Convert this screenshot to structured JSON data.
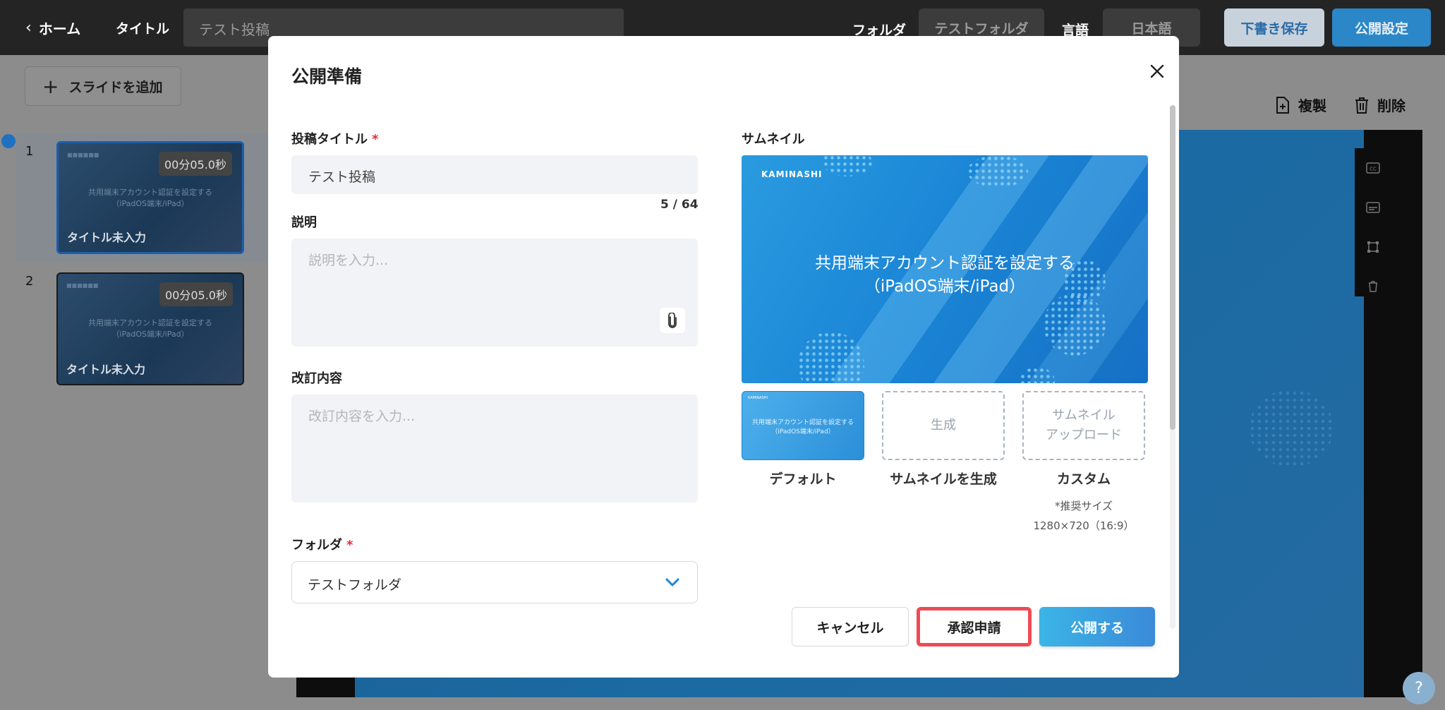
{
  "topbar": {
    "home_label": "ホーム",
    "title_label": "タイトル",
    "title_value": "テスト投稿",
    "folder_label": "フォルダ",
    "folder_value": "テストフォルダ",
    "language_label": "言語",
    "language_value": "日本語",
    "save_draft": "下書き保存",
    "publish_settings": "公開設定"
  },
  "left": {
    "add_slide": "スライドを追加",
    "slides": [
      {
        "number": "1",
        "duration": "00分05.0秒",
        "title": "タイトル未入力",
        "line1": "共用端末アカウント認証を設定する",
        "line2": "（iPadOS端末/iPad）",
        "selected": true
      },
      {
        "number": "2",
        "duration": "00分05.0秒",
        "title": "タイトル未入力",
        "line1": "共用端末アカウント認証を設定する",
        "line2": "（iPadOS端末/iPad）",
        "selected": false
      }
    ]
  },
  "toolbar": {
    "duplicate": "複製",
    "delete": "削除"
  },
  "modal": {
    "title": "公開準備",
    "post_title_label": "投稿タイトル",
    "post_title_value": "テスト投稿",
    "post_title_counter": "5 / 64",
    "description_label": "説明",
    "description_placeholder": "説明を入力...",
    "revision_label": "改訂内容",
    "revision_placeholder": "改訂内容を入力...",
    "folder_label": "フォルダ",
    "folder_value": "テストフォルダ",
    "required_mark": "*",
    "thumbnail_label": "サムネイル",
    "thumbnail": {
      "brand": "KAMINASHI",
      "line1": "共用端末アカウント認証を設定する",
      "line2": "（iPadOS端末/iPad）"
    },
    "options": {
      "default_caption": "デフォルト",
      "generate_box": "生成",
      "generate_caption": "サムネイルを生成",
      "upload_box_line1": "サムネイル",
      "upload_box_line2": "アップロード",
      "custom_caption": "カスタム",
      "recommended_line1": "*推奨サイズ",
      "recommended_line2": "1280×720（16:9）"
    },
    "buttons": {
      "cancel": "キャンセル",
      "approve": "承認申請",
      "publish": "公開する"
    }
  },
  "help": "?",
  "colors": {
    "accent": "#1b86d6",
    "highlight": "#ef4b54",
    "required": "#e0303a"
  }
}
